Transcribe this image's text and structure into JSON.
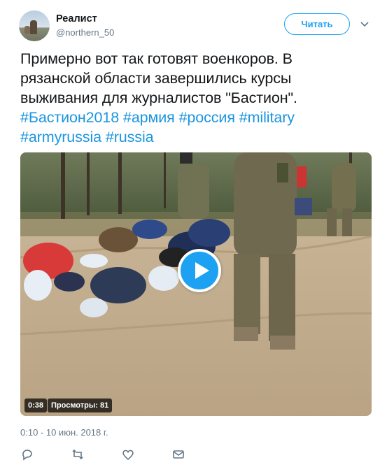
{
  "user": {
    "name": "Реалист",
    "handle": "@northern_50",
    "avatar_icon": "avatar-photo"
  },
  "follow_button": {
    "label": "Читать"
  },
  "tweet": {
    "text_line1": "Примерно вот так готовят военкоров. В",
    "text_line2": "рязанской области завершились курсы",
    "text_line3": "выживания для журналистов \"Бастион\".",
    "hashtags": [
      "#Бастион2018",
      "#армия",
      "#россия",
      "#military",
      "#armyrussia",
      "#russia"
    ]
  },
  "video": {
    "duration": "0:38",
    "views": "Просмотры: 81",
    "play_icon": "play-icon"
  },
  "timestamp": "0:10 - 10 июн. 2018 г.",
  "actions": [
    "reply-icon",
    "retweet-icon",
    "like-icon",
    "message-icon"
  ],
  "colors": {
    "accent": "#1da1f2",
    "link": "#1b95e0",
    "muted": "#657786",
    "text": "#14171a"
  }
}
